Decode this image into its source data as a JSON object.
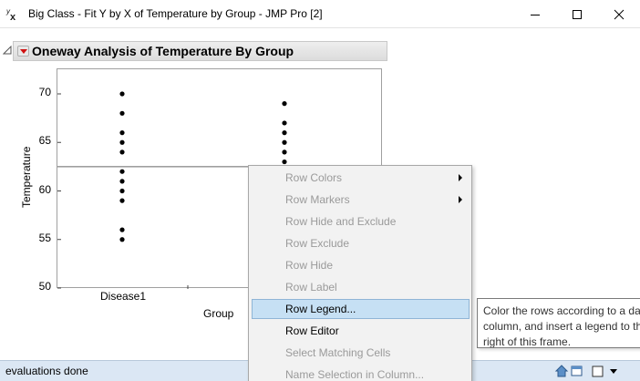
{
  "window": {
    "title": "Big Class - Fit Y by X of Temperature by Group - JMP Pro [2]"
  },
  "report": {
    "outline_title": "Oneway Analysis of Temperature By Group"
  },
  "chart_data": {
    "type": "scatter",
    "title": "",
    "xlabel": "Group",
    "ylabel": "Temperature",
    "ylim": [
      50,
      72.5
    ],
    "yticks": [
      "70",
      "65",
      "60",
      "55",
      "50"
    ],
    "categories": [
      "Disease1",
      ""
    ],
    "series": [
      {
        "category": "Disease1",
        "values": [
          70,
          68,
          66,
          65,
          64,
          62,
          61,
          60,
          59,
          56,
          55
        ]
      },
      {
        "category": "",
        "values": [
          69,
          67,
          66,
          65,
          64,
          63
        ]
      }
    ],
    "grand_mean_line": 62.5,
    "grid": false
  },
  "context_menu": {
    "items": [
      {
        "label": "Row Colors",
        "enabled": false,
        "submenu": true
      },
      {
        "label": "Row Markers",
        "enabled": false,
        "submenu": true
      },
      {
        "label": "Row Hide and Exclude",
        "enabled": false,
        "submenu": false
      },
      {
        "label": "Row Exclude",
        "enabled": false,
        "submenu": false
      },
      {
        "label": "Row Hide",
        "enabled": false,
        "submenu": false
      },
      {
        "label": "Row Label",
        "enabled": false,
        "submenu": false
      },
      {
        "label": "Row Legend...",
        "enabled": true,
        "submenu": false,
        "highlighted": true
      },
      {
        "label": "Row Editor",
        "enabled": true,
        "submenu": false
      },
      {
        "label": "Select Matching Cells",
        "enabled": false,
        "submenu": false
      },
      {
        "label": "Name Selection in Column...",
        "enabled": false,
        "submenu": false
      }
    ]
  },
  "tooltip": {
    "lines": [
      "Color the rows according to a da",
      "column, and insert a legend to th",
      "right of this frame."
    ]
  },
  "statusbar": {
    "text": "evaluations done"
  },
  "colors": {
    "statusbar_bg": "#dbe7f4",
    "menu_highlight": "#c6e0f4",
    "outline_triangle": "#d01010"
  }
}
